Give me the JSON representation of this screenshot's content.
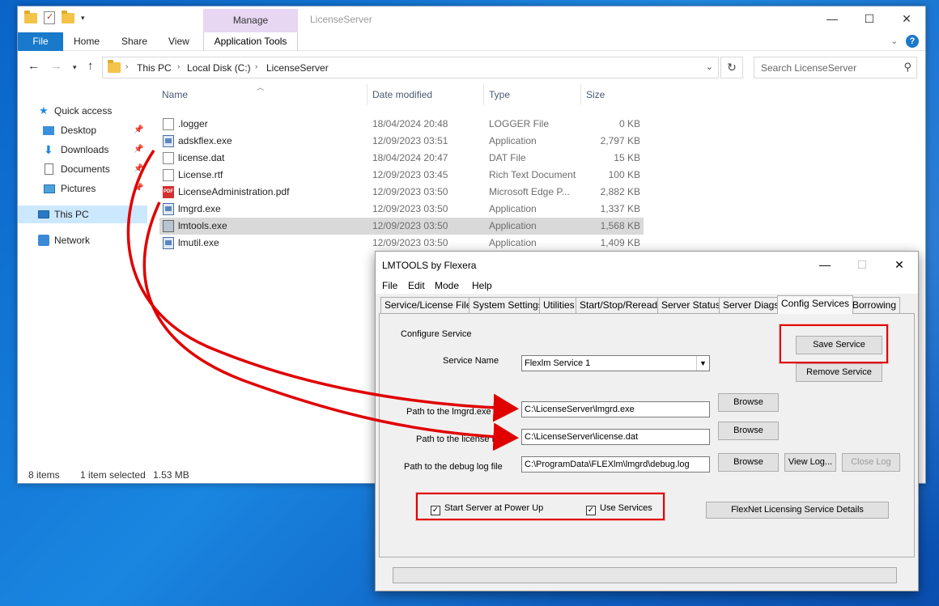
{
  "explorer": {
    "title": "LicenseServer",
    "manage_label": "Manage",
    "ribbon": {
      "file": "File",
      "home": "Home",
      "share": "Share",
      "view": "View",
      "app_tools": "Application Tools"
    },
    "breadcrumb": [
      "This PC",
      "Local Disk (C:)",
      "LicenseServer"
    ],
    "search_placeholder": "Search LicenseServer",
    "nav": {
      "quick_access": "Quick access",
      "desktop": "Desktop",
      "downloads": "Downloads",
      "documents": "Documents",
      "pictures": "Pictures",
      "this_pc": "This PC",
      "network": "Network"
    },
    "columns": {
      "name": "Name",
      "date": "Date modified",
      "type": "Type",
      "size": "Size"
    },
    "files": [
      {
        "name": ".logger",
        "date": "18/04/2024 20:48",
        "type": "LOGGER File",
        "size": "0 KB",
        "icon": "blank-file-icon"
      },
      {
        "name": "adskflex.exe",
        "date": "12/09/2023 03:51",
        "type": "Application",
        "size": "2,797 KB",
        "icon": "exe-icon"
      },
      {
        "name": "license.dat",
        "date": "18/04/2024 20:47",
        "type": "DAT File",
        "size": "15 KB",
        "icon": "blank-file-icon"
      },
      {
        "name": "License.rtf",
        "date": "12/09/2023 03:45",
        "type": "Rich Text Document",
        "size": "100 KB",
        "icon": "blank-file-icon"
      },
      {
        "name": "LicenseAdministration.pdf",
        "date": "12/09/2023 03:50",
        "type": "Microsoft Edge P...",
        "size": "2,882 KB",
        "icon": "pdf-icon"
      },
      {
        "name": "lmgrd.exe",
        "date": "12/09/2023 03:50",
        "type": "Application",
        "size": "1,337 KB",
        "icon": "exe-icon"
      },
      {
        "name": "lmtools.exe",
        "date": "12/09/2023 03:50",
        "type": "Application",
        "size": "1,568 KB",
        "icon": "tool-icon"
      },
      {
        "name": "lmutil.exe",
        "date": "12/09/2023 03:50",
        "type": "Application",
        "size": "1,409 KB",
        "icon": "exe-icon"
      }
    ],
    "status": {
      "items": "8 items",
      "selected": "1 item selected",
      "size": "1.53 MB"
    }
  },
  "lmtools": {
    "title": "LMTOOLS by Flexera",
    "menu": [
      "File",
      "Edit",
      "Mode",
      "Help"
    ],
    "tabs": [
      "Service/License File",
      "System Settings",
      "Utilities",
      "Start/Stop/Reread",
      "Server Status",
      "Server Diags",
      "Config Services",
      "Borrowing"
    ],
    "active_tab": "Config Services",
    "configure_service": "Configure Service",
    "service_name_label": "Service Name",
    "service_name_value": "Flexlm Service 1",
    "save_service": "Save Service",
    "remove_service": "Remove Service",
    "lmgrd_label": "Path to the lmgrd.exe file",
    "lmgrd_value": "C:\\LicenseServer\\lmgrd.exe",
    "license_label": "Path to the license file",
    "license_value": "C:\\LicenseServer\\license.dat",
    "debug_label": "Path to the debug log file",
    "debug_value": "C:\\ProgramData\\FLEXlm\\lmgrd\\debug.log",
    "browse": "Browse",
    "view_log": "View Log...",
    "close_log": "Close Log",
    "start_server": "Start Server at Power Up",
    "use_services": "Use Services",
    "flexnet_details": "FlexNet Licensing Service Details",
    "start_server_checked": true,
    "use_services_checked": true
  },
  "colors": {
    "highlight": "#e00000",
    "file_tab": "#1979ca",
    "manage_tab": "#e7d7f3",
    "selection": "#cce8ff"
  }
}
